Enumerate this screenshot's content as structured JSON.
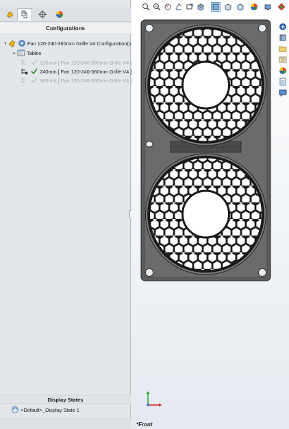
{
  "feature_manager": {
    "tabs": [
      {
        "name": "featuremanager-tab",
        "icon": "feature-tree-icon",
        "active": false
      },
      {
        "name": "propertymanager-tab",
        "icon": "property-manager-icon",
        "active": true
      },
      {
        "name": "configurationmanager-tab",
        "icon": "configuration-target-icon",
        "active": false
      },
      {
        "name": "displaymanager-tab",
        "icon": "appearance-pie-icon",
        "active": false
      }
    ],
    "configurations_header": "Configurations",
    "tree": {
      "root_label": "Fan 120-240-360mm Grille V4 Configuration(s",
      "tables_label": "Tables",
      "configs": [
        {
          "label": "120mm [ Fan 120-240-360mm Grille V4 ]",
          "active": false
        },
        {
          "label": "240mm [ Fan 120-240-360mm Grille V4 ]",
          "active": true
        },
        {
          "label": "360mm [ Fan 120-240-360mm Grille V4 ]",
          "active": false
        }
      ]
    },
    "display_states_header": "Display States",
    "display_state_label": "<Default>_Display State 1"
  },
  "viewport": {
    "view_label": "*Front",
    "background_color": "#f3f6f9",
    "model_color": "#5c5c5c",
    "toolbar_icons": [
      "zoom-to-fit-icon",
      "zoom-to-area-icon",
      "previous-view-icon",
      "section-view-icon",
      "dynamic-annotation-icon",
      "view-orientation-icon",
      "display-style-icon",
      "hide-show-items-icon",
      "edit-appearance-icon",
      "apply-scene-icon",
      "view-settings-icon"
    ],
    "taskpane_icons": [
      "solidworks-resources-icon",
      "design-library-icon",
      "file-explorer-icon",
      "view-palette-icon",
      "appearances-icon",
      "custom-properties-icon",
      "solidworks-forum-icon"
    ]
  }
}
